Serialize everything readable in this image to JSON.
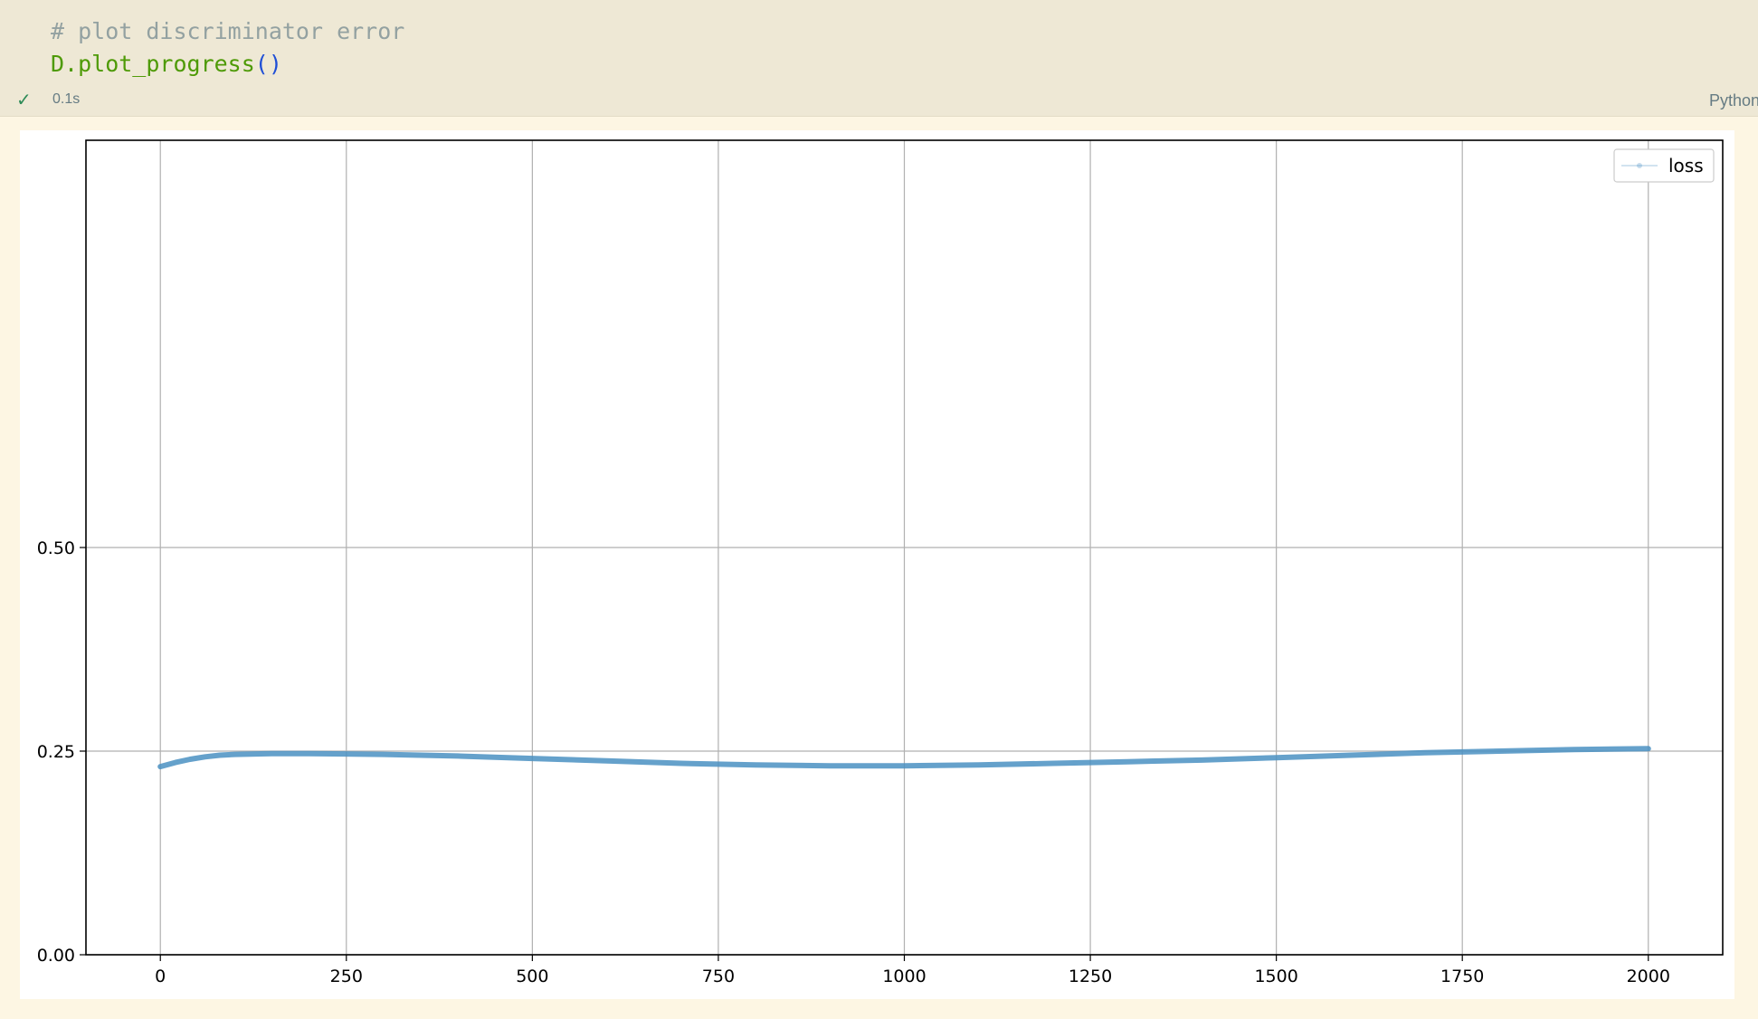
{
  "cell": {
    "code": {
      "comment": "# plot discriminator error",
      "call_prefix": "D.plot_progress",
      "call_parens": "()"
    },
    "status": {
      "check_icon": "check-icon",
      "exec_time": "0.1s",
      "language": "Python"
    }
  },
  "chart_data": {
    "type": "line",
    "title": "",
    "xlabel": "",
    "ylabel": "",
    "xlim": [
      -100,
      2100
    ],
    "ylim": [
      0.0,
      1.0
    ],
    "xticks": [
      0,
      250,
      500,
      750,
      1000,
      1250,
      1500,
      1750,
      2000
    ],
    "yticks": [
      0.0,
      0.25,
      0.5
    ],
    "xtick_labels": [
      "0",
      "250",
      "500",
      "750",
      "1000",
      "1250",
      "1500",
      "1750",
      "2000"
    ],
    "ytick_labels": [
      "0.00",
      "0.25",
      "0.50"
    ],
    "grid": true,
    "legend_position": "top-right",
    "series": [
      {
        "name": "loss",
        "color": "#4a90c2",
        "x": [
          0,
          20,
          40,
          60,
          80,
          100,
          150,
          200,
          300,
          400,
          500,
          600,
          700,
          800,
          900,
          1000,
          1100,
          1200,
          1300,
          1400,
          1500,
          1600,
          1700,
          1800,
          1900,
          2000
        ],
        "y": [
          0.231,
          0.236,
          0.24,
          0.243,
          0.245,
          0.246,
          0.247,
          0.247,
          0.246,
          0.244,
          0.241,
          0.238,
          0.235,
          0.233,
          0.232,
          0.232,
          0.233,
          0.235,
          0.237,
          0.239,
          0.242,
          0.245,
          0.248,
          0.25,
          0.252,
          0.253
        ]
      }
    ]
  }
}
